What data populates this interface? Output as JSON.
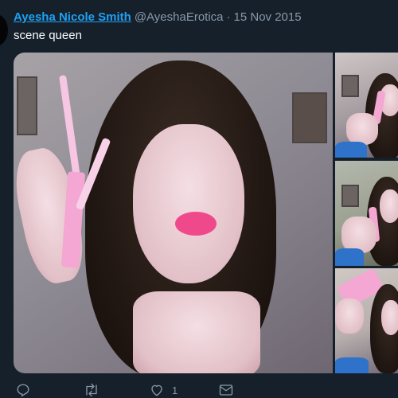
{
  "tweet": {
    "author_name": "Ayesha Nicole Smith",
    "handle": "@AyeshaErotica",
    "separator": "·",
    "date": "15 Nov 2015",
    "text": "scene queen",
    "media_count": 4
  },
  "actions": {
    "reply_icon": "reply-icon",
    "retweet_icon": "retweet-icon",
    "like_icon": "like-icon",
    "like_count": "1",
    "message_icon": "message-icon"
  },
  "colors": {
    "background": "#15202b",
    "link": "#1da1f2",
    "secondary_text": "#8899a6",
    "primary_text": "#ffffff"
  }
}
